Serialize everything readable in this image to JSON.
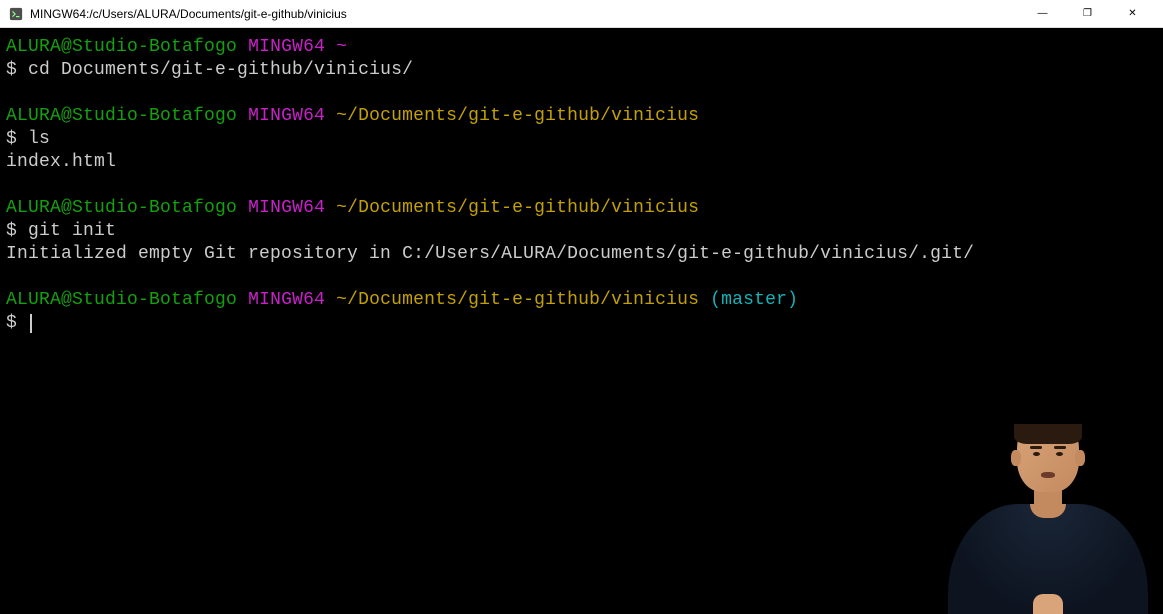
{
  "titlebar": {
    "title": "MINGW64:/c/Users/ALURA/Documents/git-e-github/vinicius",
    "controls": {
      "minimize": "—",
      "maximize": "❐",
      "close": "✕"
    }
  },
  "prompt": {
    "user_host": "ALURA@Studio-Botafogo",
    "mingw": "MINGW64",
    "tilde": "~",
    "path_short": "~/Documents/git-e-github/vinicius",
    "branch": "(master)",
    "dollar": "$"
  },
  "blocks": [
    {
      "prompt_path": "~",
      "show_branch": false,
      "command": "cd Documents/git-e-github/vinicius/",
      "output": []
    },
    {
      "prompt_path": "~/Documents/git-e-github/vinicius",
      "show_branch": false,
      "command": "ls",
      "output": [
        "index.html"
      ]
    },
    {
      "prompt_path": "~/Documents/git-e-github/vinicius",
      "show_branch": false,
      "command": "git init",
      "output": [
        "Initialized empty Git repository in C:/Users/ALURA/Documents/git-e-github/vinicius/.git/"
      ]
    },
    {
      "prompt_path": "~/Documents/git-e-github/vinicius",
      "show_branch": true,
      "command": "",
      "output": []
    }
  ]
}
